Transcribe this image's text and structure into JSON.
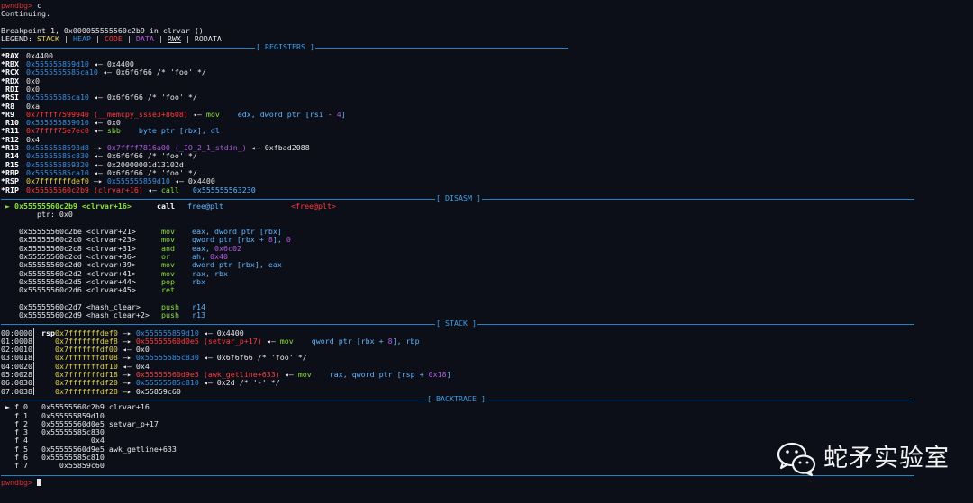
{
  "prompt": {
    "name": "pwndbg>",
    "cmd": " c"
  },
  "status": {
    "continuing": "Continuing.",
    "breakpoint": "Breakpoint 1, 0x000055555560c2b9 in clrvar ()"
  },
  "legend": {
    "label": "LEGEND:",
    "stack": "STACK",
    "heap": "HEAP",
    "code": "CODE",
    "data": "DATA",
    "rwx": "RWX",
    "rodata": "RODATA"
  },
  "sections": {
    "registers": "[ REGISTERS ]",
    "disasm": "[ DISASM ]",
    "stack": "[ STACK ]",
    "backtrace": "[ BACKTRACE ]"
  },
  "registers": [
    {
      "name": "*RAX",
      "segs": [
        {
          "t": "0x4400",
          "c": "w"
        }
      ]
    },
    {
      "name": "*RBX",
      "segs": [
        {
          "t": "0x555555859d10",
          "c": "b"
        },
        {
          "t": " ◂— 0x4400",
          "c": "w"
        }
      ]
    },
    {
      "name": "*RCX",
      "segs": [
        {
          "t": "0x5555555585ca10",
          "c": "b"
        },
        {
          "t": " ◂— 0x6f6f66 /* 'foo' */",
          "c": "w"
        }
      ]
    },
    {
      "name": "*RDX",
      "segs": [
        {
          "t": "0x0",
          "c": "w"
        }
      ]
    },
    {
      "name": " RDI",
      "segs": [
        {
          "t": "0x0",
          "c": "w"
        }
      ]
    },
    {
      "name": "*RSI",
      "segs": [
        {
          "t": "0x55555585ca10",
          "c": "b"
        },
        {
          "t": " ◂— 0x6f6f66 /* 'foo' */",
          "c": "w"
        }
      ]
    },
    {
      "name": "*R8 ",
      "segs": [
        {
          "t": "0xa",
          "c": "w"
        }
      ]
    },
    {
      "name": "*R9 ",
      "segs": [
        {
          "t": "0x7ffff7599940",
          "c": "r"
        },
        {
          "t": " (__memcpy_ssse3+8608)",
          "c": "r"
        },
        {
          "t": " ◂— ",
          "c": "w"
        },
        {
          "t": "mov",
          "c": "g"
        },
        {
          "t": "    edx, dword ptr [rsi - ",
          "c": "c"
        },
        {
          "t": "4",
          "c": "p"
        },
        {
          "t": "]",
          "c": "c"
        }
      ]
    },
    {
      "name": " R10",
      "segs": [
        {
          "t": "0x555555859010",
          "c": "b"
        },
        {
          "t": " ◂— 0x0",
          "c": "w"
        }
      ]
    },
    {
      "name": "*R11",
      "segs": [
        {
          "t": "0x7ffff75e7ec0",
          "c": "r"
        },
        {
          "t": " ◂— ",
          "c": "w"
        },
        {
          "t": "sbb",
          "c": "g"
        },
        {
          "t": "    byte ptr [rbx], dl",
          "c": "c"
        }
      ]
    },
    {
      "name": "*R12",
      "segs": [
        {
          "t": "0x4",
          "c": "w"
        }
      ]
    },
    {
      "name": "*R13",
      "segs": [
        {
          "t": "0x5555558593d8",
          "c": "b"
        },
        {
          "t": " —▸ ",
          "c": "w"
        },
        {
          "t": "0x7ffff7816a00",
          "c": "p"
        },
        {
          "t": " (_IO_2_1_stdin_)",
          "c": "p"
        },
        {
          "t": " ◂— 0xfbad2088",
          "c": "w"
        }
      ]
    },
    {
      "name": " R14",
      "segs": [
        {
          "t": "0x55555585c830",
          "c": "b"
        },
        {
          "t": " ◂— 0x6f6f66 /* 'foo' */",
          "c": "w"
        }
      ]
    },
    {
      "name": " R15",
      "segs": [
        {
          "t": "0x555555859320",
          "c": "b"
        },
        {
          "t": " ◂— 0x20000001d13102d",
          "c": "w"
        }
      ]
    },
    {
      "name": "*RBP",
      "segs": [
        {
          "t": "0x55555585ca10",
          "c": "b"
        },
        {
          "t": " ◂— 0x6f6f66 /* 'foo' */",
          "c": "w"
        }
      ]
    },
    {
      "name": "*RSP",
      "segs": [
        {
          "t": "0x7fffffffdef0",
          "c": "y"
        },
        {
          "t": " —▸ ",
          "c": "w"
        },
        {
          "t": "0x555555859d10",
          "c": "b"
        },
        {
          "t": " ◂— 0x4400",
          "c": "w"
        }
      ]
    },
    {
      "name": "*RIP",
      "segs": [
        {
          "t": "0x55555560c2b9",
          "c": "r"
        },
        {
          "t": " (clrvar+16)",
          "c": "r"
        },
        {
          "t": " ◂— ",
          "c": "w"
        },
        {
          "t": "call",
          "c": "g"
        },
        {
          "t": "   0x555555563230",
          "c": "c"
        }
      ]
    }
  ],
  "disasm": {
    "current": {
      "arrow": " ► ",
      "addr": "0x55555560c2b9 <clrvar+16>",
      "mnem": "call",
      "op": "free@plt",
      "target": "<free@plt>"
    },
    "ptr_line": "        ptr: 0x0",
    "lines": [
      {
        "addr": "0x55555560c2be <clrvar+21>",
        "mnem": "mov",
        "segs": [
          {
            "t": "eax, dword ptr [rbx]",
            "c": "c"
          }
        ]
      },
      {
        "addr": "0x55555560c2c0 <clrvar+23>",
        "mnem": "mov",
        "segs": [
          {
            "t": "qword ptr [rbx + ",
            "c": "c"
          },
          {
            "t": "8",
            "c": "p"
          },
          {
            "t": "], ",
            "c": "c"
          },
          {
            "t": "0",
            "c": "p"
          }
        ]
      },
      {
        "addr": "0x55555560c2c8 <clrvar+31>",
        "mnem": "and",
        "segs": [
          {
            "t": "eax, ",
            "c": "c"
          },
          {
            "t": "0x6c02",
            "c": "p"
          }
        ]
      },
      {
        "addr": "0x55555560c2cd <clrvar+36>",
        "mnem": "or",
        "segs": [
          {
            "t": "ah, ",
            "c": "c"
          },
          {
            "t": "0x40",
            "c": "p"
          }
        ]
      },
      {
        "addr": "0x55555560c2d0 <clrvar+39>",
        "mnem": "mov",
        "segs": [
          {
            "t": "dword ptr [rbx], eax",
            "c": "c"
          }
        ]
      },
      {
        "addr": "0x55555560c2d2 <clrvar+41>",
        "mnem": "mov",
        "segs": [
          {
            "t": "rax, rbx",
            "c": "c"
          }
        ]
      },
      {
        "addr": "0x55555560c2d5 <clrvar+44>",
        "mnem": "pop",
        "segs": [
          {
            "t": "rbx",
            "c": "c"
          }
        ]
      },
      {
        "addr": "0x55555560c2d6 <clrvar+45>",
        "mnem": "ret",
        "segs": []
      },
      {
        "addr": "",
        "mnem": "",
        "segs": []
      },
      {
        "addr": "0x55555560c2d7 <hash_clear>",
        "mnem": "push",
        "segs": [
          {
            "t": "r14",
            "c": "c"
          }
        ]
      },
      {
        "addr": "0x55555560c2d9 <hash_clear+2>",
        "mnem": "push",
        "segs": [
          {
            "t": "r13",
            "c": "c"
          }
        ]
      }
    ]
  },
  "stack": [
    {
      "off": "00:0000",
      "reg": " rsp ",
      "segs": [
        {
          "t": "0x7fffffffdef0",
          "c": "y"
        },
        {
          "t": " —▸ ",
          "c": "w"
        },
        {
          "t": "0x555555859d10",
          "c": "b"
        },
        {
          "t": " ◂— 0x4400",
          "c": "w"
        }
      ]
    },
    {
      "off": "01:0008",
      "reg": "     ",
      "segs": [
        {
          "t": "0x7fffffffdef8",
          "c": "y"
        },
        {
          "t": " —▸ ",
          "c": "w"
        },
        {
          "t": "0x55555560d0e5",
          "c": "r"
        },
        {
          "t": " (setvar_p+17)",
          "c": "r"
        },
        {
          "t": " ◂— ",
          "c": "w"
        },
        {
          "t": "mov",
          "c": "g"
        },
        {
          "t": "    qword ptr [rbx + ",
          "c": "c"
        },
        {
          "t": "8",
          "c": "p"
        },
        {
          "t": "], rbp",
          "c": "c"
        }
      ]
    },
    {
      "off": "02:0010",
      "reg": "     ",
      "segs": [
        {
          "t": "0x7fffffffdf00",
          "c": "y"
        },
        {
          "t": " ◂— 0x0",
          "c": "w"
        }
      ]
    },
    {
      "off": "03:0018",
      "reg": "     ",
      "segs": [
        {
          "t": "0x7fffffffdf08",
          "c": "y"
        },
        {
          "t": " —▸ ",
          "c": "w"
        },
        {
          "t": "0x55555585c830",
          "c": "b"
        },
        {
          "t": " ◂— 0x6f6f66 /* 'foo' */",
          "c": "w"
        }
      ]
    },
    {
      "off": "04:0020",
      "reg": "     ",
      "segs": [
        {
          "t": "0x7fffffffdf10",
          "c": "y"
        },
        {
          "t": " ◂— 0x4",
          "c": "w"
        }
      ]
    },
    {
      "off": "05:0028",
      "reg": "     ",
      "segs": [
        {
          "t": "0x7fffffffdf18",
          "c": "y"
        },
        {
          "t": " —▸ ",
          "c": "w"
        },
        {
          "t": "0x55555560d9e5",
          "c": "r"
        },
        {
          "t": " (awk_getline+633)",
          "c": "r"
        },
        {
          "t": " ◂— ",
          "c": "w"
        },
        {
          "t": "mov",
          "c": "g"
        },
        {
          "t": "    rax, qword ptr [rsp + ",
          "c": "c"
        },
        {
          "t": "0x18",
          "c": "p"
        },
        {
          "t": "]",
          "c": "c"
        }
      ]
    },
    {
      "off": "06:0030",
      "reg": "     ",
      "segs": [
        {
          "t": "0x7fffffffdf20",
          "c": "y"
        },
        {
          "t": " —▸ ",
          "c": "w"
        },
        {
          "t": "0x55555585c810",
          "c": "b"
        },
        {
          "t": " ◂— 0x2d /* '-' */",
          "c": "w"
        }
      ]
    },
    {
      "off": "07:0038",
      "reg": "     ",
      "segs": [
        {
          "t": "0x7fffffffdf28",
          "c": "y"
        },
        {
          "t": " —▸ 0x55859c60",
          "c": "w"
        }
      ]
    }
  ],
  "backtrace": [
    {
      "t": " ► f 0   0x55555560c2b9 clrvar+16"
    },
    {
      "t": "   f 1   0x555555859d10"
    },
    {
      "t": "   f 2   0x55555560d0e5 setvar_p+17"
    },
    {
      "t": "   f 3   0x55555585c830"
    },
    {
      "t": "   f 4              0x4"
    },
    {
      "t": "   f 5   0x55555560d9e5 awk_getline+633"
    },
    {
      "t": "   f 6   0x55555585c810"
    },
    {
      "t": "   f 7       0x55859c60"
    }
  ],
  "watermark": {
    "text": "蛇矛实验室",
    "icon": "wechat-icon"
  },
  "colors": {
    "bg": "#0c0e18",
    "red": "#ff3b3b",
    "blue": "#3a8fe0",
    "purple": "#b05ce0",
    "yellow": "#e6d24a",
    "green": "#8ae234",
    "cyan": "#5fb7ff"
  }
}
